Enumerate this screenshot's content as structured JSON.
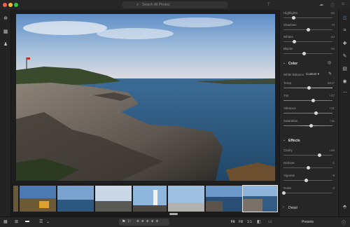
{
  "search": {
    "placeholder": "Search All Photos"
  },
  "colors": {
    "window_bg": "#1e1e1e",
    "panel_bg": "#262626",
    "accent_blue": "#1d8ae8",
    "traffic_close": "#f35e56",
    "traffic_min": "#fbbc2f",
    "traffic_max": "#29c93f"
  },
  "top_icons": [
    "filter-icon",
    "cloud-icon",
    "help-icon",
    "user-icon"
  ],
  "left_nav": [
    "add-photos-icon",
    "library-icon",
    "people-icon"
  ],
  "panel": {
    "light_rows": [
      {
        "label": "Highlights",
        "value": "-46",
        "level": 0.2
      },
      {
        "label": "Shadows",
        "value": "+0",
        "level": 0.5
      },
      {
        "label": "Whites",
        "value": "-43",
        "level": 0.22
      },
      {
        "label": "Blacks",
        "value": "-16",
        "level": 0.42
      }
    ],
    "color": {
      "title": "Color",
      "white_balance_label": "White Balance",
      "white_balance_value": "Custom",
      "rows": [
        {
          "label": "Temp",
          "value": "6017",
          "level": 0.52,
          "gradient": "temp"
        },
        {
          "label": "Tint",
          "value": "+27",
          "level": 0.6,
          "gradient": "tint"
        },
        {
          "label": "Vibrance",
          "value": "+31",
          "level": 0.66,
          "gradient": "vibrance"
        },
        {
          "label": "Saturation",
          "value": "+11",
          "level": 0.56,
          "gradient": "saturation"
        }
      ]
    },
    "effects": {
      "title": "Effects",
      "rows": [
        {
          "label": "Clarity",
          "value": "+46",
          "level": 0.73
        },
        {
          "label": "Dehaze",
          "value": "-1",
          "level": 0.5
        },
        {
          "label": "Vignette",
          "value": "-5",
          "level": 0.47
        },
        {
          "label": "Grain",
          "value": "0",
          "level": 0.0
        }
      ]
    },
    "detail_title": "Detail",
    "presets_label": "Presets"
  },
  "right_icons": [
    "edit-sliders-icon",
    "crop-icon",
    "healing-brush-icon",
    "brush-icon",
    "linear-gradient-icon",
    "radial-gradient-icon",
    "more-icon"
  ],
  "bottom_bar": {
    "fit_label": "Fit",
    "fill_label": "Fill",
    "ratio_label": "1:1",
    "rating_stars": 5,
    "rating_value": 0
  }
}
